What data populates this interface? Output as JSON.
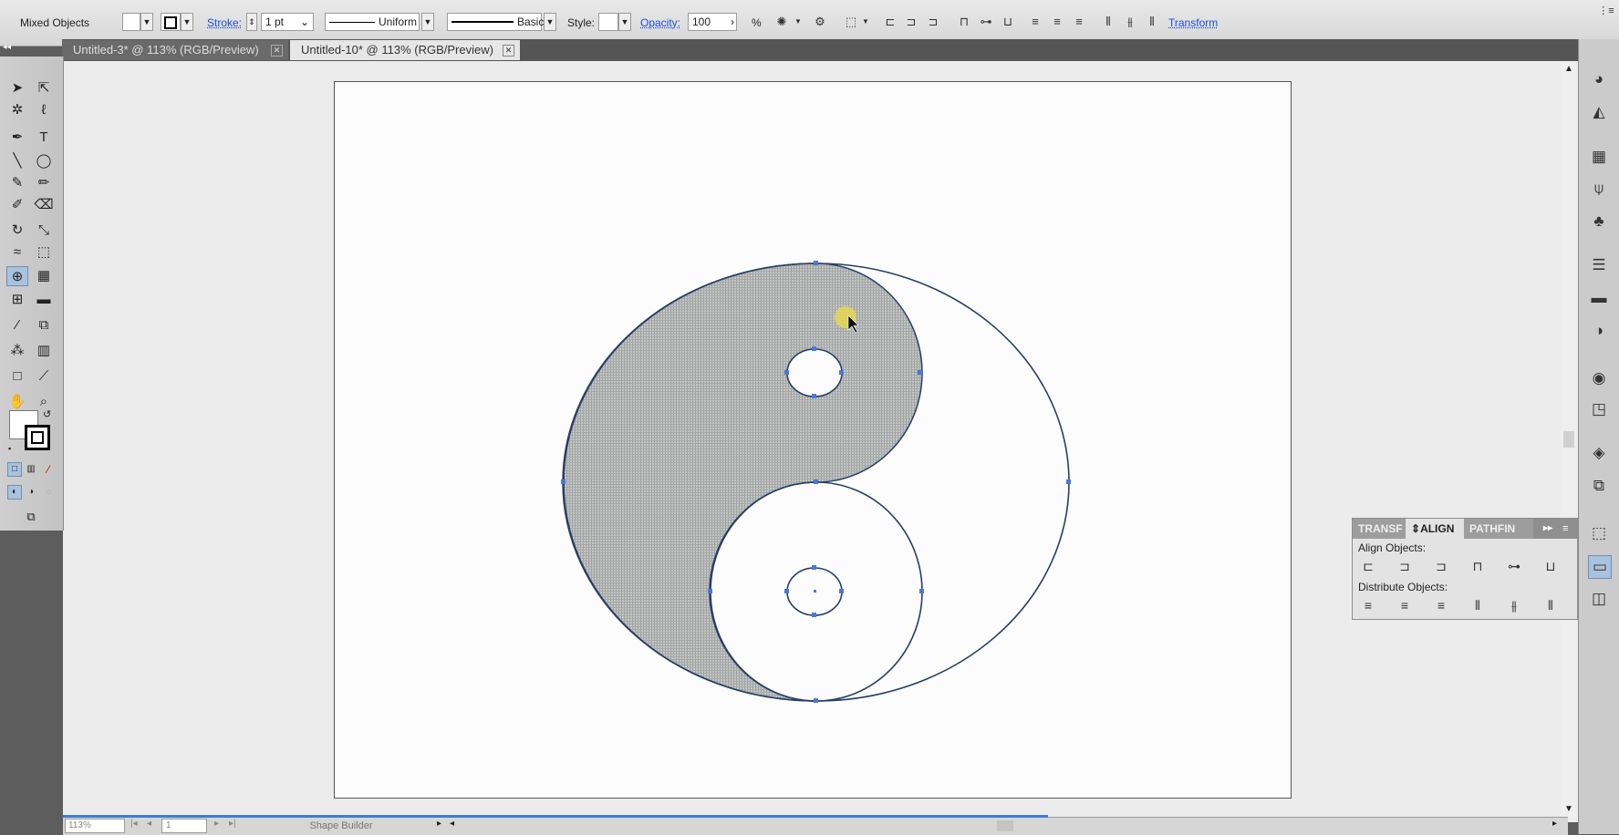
{
  "control_bar": {
    "selection_label": "Mixed Objects",
    "stroke_label": "Stroke:",
    "stroke_weight": "1 pt",
    "profile_label": "Uniform",
    "brush_label": "Basic",
    "style_label": "Style:",
    "opacity_label": "Opacity:",
    "opacity_value": "100",
    "opacity_unit": "%",
    "transform_label": "Transform",
    "align_icons": [
      "align-left-icon",
      "align-hcenter-icon",
      "align-right-icon",
      "align-top-icon",
      "align-vcenter-icon",
      "align-bottom-icon",
      "distribute-top-icon",
      "distribute-vcenter-icon",
      "distribute-bottom-icon",
      "distribute-left-icon",
      "distribute-hcenter-icon",
      "distribute-right-icon"
    ]
  },
  "tabs": [
    {
      "label": "Untitled-3* @ 113% (RGB/Preview)",
      "active": false
    },
    {
      "label": "Untitled-10* @ 113% (RGB/Preview)",
      "active": true
    }
  ],
  "tools": [
    {
      "name": "selection-tool",
      "glyph": "➤"
    },
    {
      "name": "direct-selection-tool",
      "glyph": "⇱"
    },
    {
      "name": "magic-wand-tool",
      "glyph": "✲"
    },
    {
      "name": "lasso-tool",
      "glyph": "ℓ"
    },
    {
      "name": "pen-tool",
      "glyph": "✒"
    },
    {
      "name": "type-tool",
      "glyph": "T"
    },
    {
      "name": "line-segment-tool",
      "glyph": "╲"
    },
    {
      "name": "ellipse-tool",
      "glyph": "◯"
    },
    {
      "name": "paintbrush-tool",
      "glyph": "✎"
    },
    {
      "name": "pencil-tool",
      "glyph": "✏"
    },
    {
      "name": "blob-brush-tool",
      "glyph": "✐"
    },
    {
      "name": "eraser-tool",
      "glyph": "⌫"
    },
    {
      "name": "rotate-tool",
      "glyph": "↻"
    },
    {
      "name": "scale-tool",
      "glyph": "⤡"
    },
    {
      "name": "warp-tool",
      "glyph": "≈"
    },
    {
      "name": "free-transform-tool",
      "glyph": "⬚"
    },
    {
      "name": "shape-builder-tool",
      "glyph": "⊕"
    },
    {
      "name": "perspective-grid-tool",
      "glyph": "▦"
    },
    {
      "name": "mesh-tool",
      "glyph": "⊞"
    },
    {
      "name": "gradient-tool",
      "glyph": "▬"
    },
    {
      "name": "eyedropper-tool",
      "glyph": "⁄"
    },
    {
      "name": "blend-tool",
      "glyph": "⧉"
    },
    {
      "name": "symbol-sprayer-tool",
      "glyph": "⁂"
    },
    {
      "name": "column-graph-tool",
      "glyph": "▥"
    },
    {
      "name": "artboard-tool",
      "glyph": "□"
    },
    {
      "name": "slice-tool",
      "glyph": "⟋"
    },
    {
      "name": "hand-tool",
      "glyph": "✋"
    },
    {
      "name": "zoom-tool",
      "glyph": "⌕"
    }
  ],
  "dock_icons": [
    "color-icon",
    "color-guide-icon",
    "swatches-icon",
    "brushes-icon",
    "symbols-icon",
    "stroke-icon",
    "gradient-icon",
    "transparency-icon",
    "appearance-icon",
    "graphic-styles-icon",
    "layers-icon",
    "artboards-icon",
    "transform-icon",
    "align-icon",
    "pathfinder-icon"
  ],
  "align_panel": {
    "tab_transform": "TRANSF",
    "tab_align": "ALIGN",
    "tab_pathfinder": "PATHFIN",
    "align_objects_label": "Align Objects:",
    "distribute_objects_label": "Distribute Objects:"
  },
  "status_bar": {
    "zoom": "113%",
    "artboard_number": "1",
    "tool_name": "Shape Builder"
  },
  "colors": {
    "selection_blue": "#4a78d8",
    "shape_fill": "#b9bcbb",
    "artboard": "#fbfcfb",
    "cursor_highlight": "#e8d84a"
  }
}
